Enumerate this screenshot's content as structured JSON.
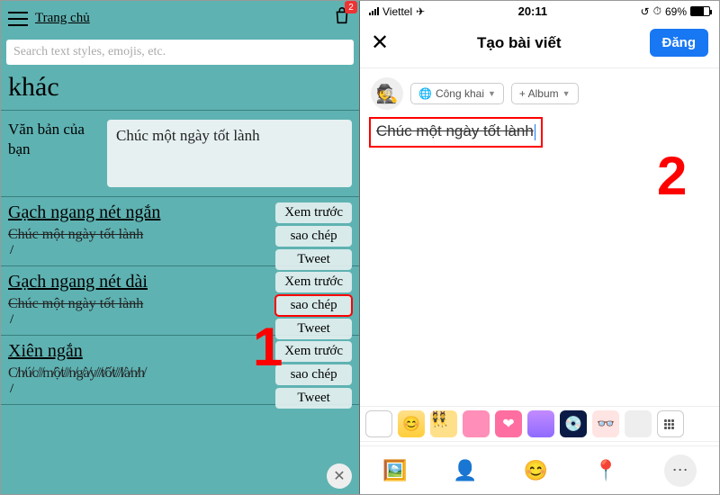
{
  "left": {
    "home_link": "Trang chủ",
    "shop_badge": "2",
    "search_placeholder": "Search text styles, emojis, etc.",
    "heading": "khác",
    "input_label": "Văn bản của bạn",
    "input_value": "Chúc một ngày tốt lành",
    "styles": [
      {
        "name": "Gạch ngang nét ngắn",
        "sample": "Chúc một ngày tốt lành",
        "sample_class": "strike-short",
        "buttons": [
          "Xem trước",
          "sao chép",
          "Tweet"
        ],
        "highlight_index": -1
      },
      {
        "name": "Gạch ngang nét dài",
        "sample": "Chúc một ngày tốt lành",
        "sample_class": "strike-long",
        "buttons": [
          "Xem trước",
          "sao chép",
          "Tweet"
        ],
        "highlight_index": 1
      },
      {
        "name": "Xiên ngắn",
        "sample": "C̸h̸ú̸c̸/̸m̸ộ̸t̸/̸n̸g̸à̸y̸/̸t̸ố̸t̸/̸l̸à̸n̸h̸",
        "sample_class": "",
        "buttons": [
          "Xem trước",
          "sao chép",
          "Tweet"
        ],
        "highlight_index": -1
      }
    ],
    "step_number": "1"
  },
  "right": {
    "status": {
      "carrier": "Viettel",
      "time": "20:11",
      "battery": "69%"
    },
    "title": "Tạo bài viết",
    "post_button": "Đăng",
    "privacy_chip": "Công khai",
    "album_chip": "+ Album",
    "compose_text": "Chúc một ngày tốt lành",
    "bg_colors": [
      "#ffffff",
      "#ffe08a",
      "#ffa9d0",
      "#ff6ea0",
      "#ff7fbf",
      "#c38bff",
      "#1b1b2e",
      "#ffe4e4",
      "#ddd"
    ],
    "step_number": "2"
  }
}
